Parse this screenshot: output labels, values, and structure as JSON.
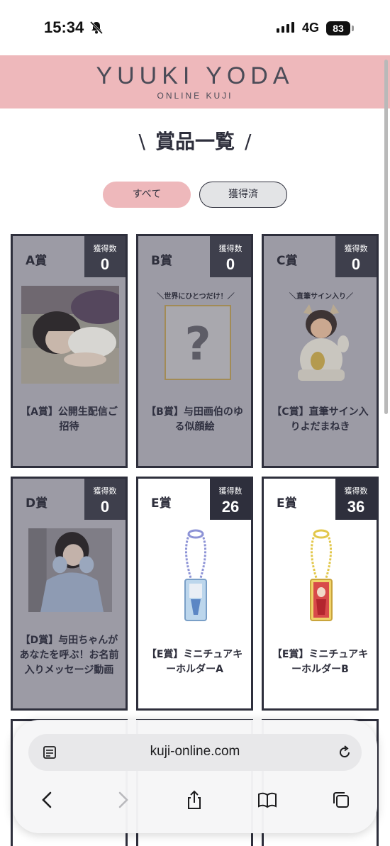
{
  "status": {
    "time": "15:34",
    "network": "4G",
    "battery": "83"
  },
  "header": {
    "brand": "YUUKI YODA",
    "subtitle": "ONLINE KUJI"
  },
  "section": {
    "title": "賞品一覧",
    "left_slash": "\\",
    "right_slash": "/"
  },
  "tabs": [
    {
      "label": "すべて",
      "active": true
    },
    {
      "label": "獲得済",
      "active": false
    }
  ],
  "count_label": "獲得数",
  "cards": [
    {
      "label": "A賞",
      "count": "0",
      "name": "【A賞】公開生配信ご招待",
      "icon": "photo-lying-icon"
    },
    {
      "label": "B賞",
      "count": "0",
      "name": "【B賞】与田画伯のゆる似顔絵",
      "caption": "＼世界にひとつだけ！／",
      "icon": "question-frame-icon"
    },
    {
      "label": "C賞",
      "count": "0",
      "name": "【C賞】直筆サイン入りよだまねき",
      "caption": "＼直筆サイン入り／",
      "icon": "maneki-figure-icon"
    },
    {
      "label": "D賞",
      "count": "0",
      "name": "【D賞】与田ちゃんがあなたを呼ぶ！お名前入りメッセージ動画",
      "icon": "photo-sweater-icon"
    },
    {
      "label": "E賞",
      "count": "26",
      "name": "【E賞】ミニチュアキーホルダーA",
      "icon": "keychain-blue-icon"
    },
    {
      "label": "E賞",
      "count": "36",
      "name": "【E賞】ミニチュアキーホルダーB",
      "icon": "keychain-red-icon"
    }
  ],
  "browser": {
    "url": "kuji-online.com"
  },
  "colors": {
    "header_pink": "#eeb8bb",
    "navy": "#2e2f3c",
    "won_overlay": "#9c9ba5"
  }
}
